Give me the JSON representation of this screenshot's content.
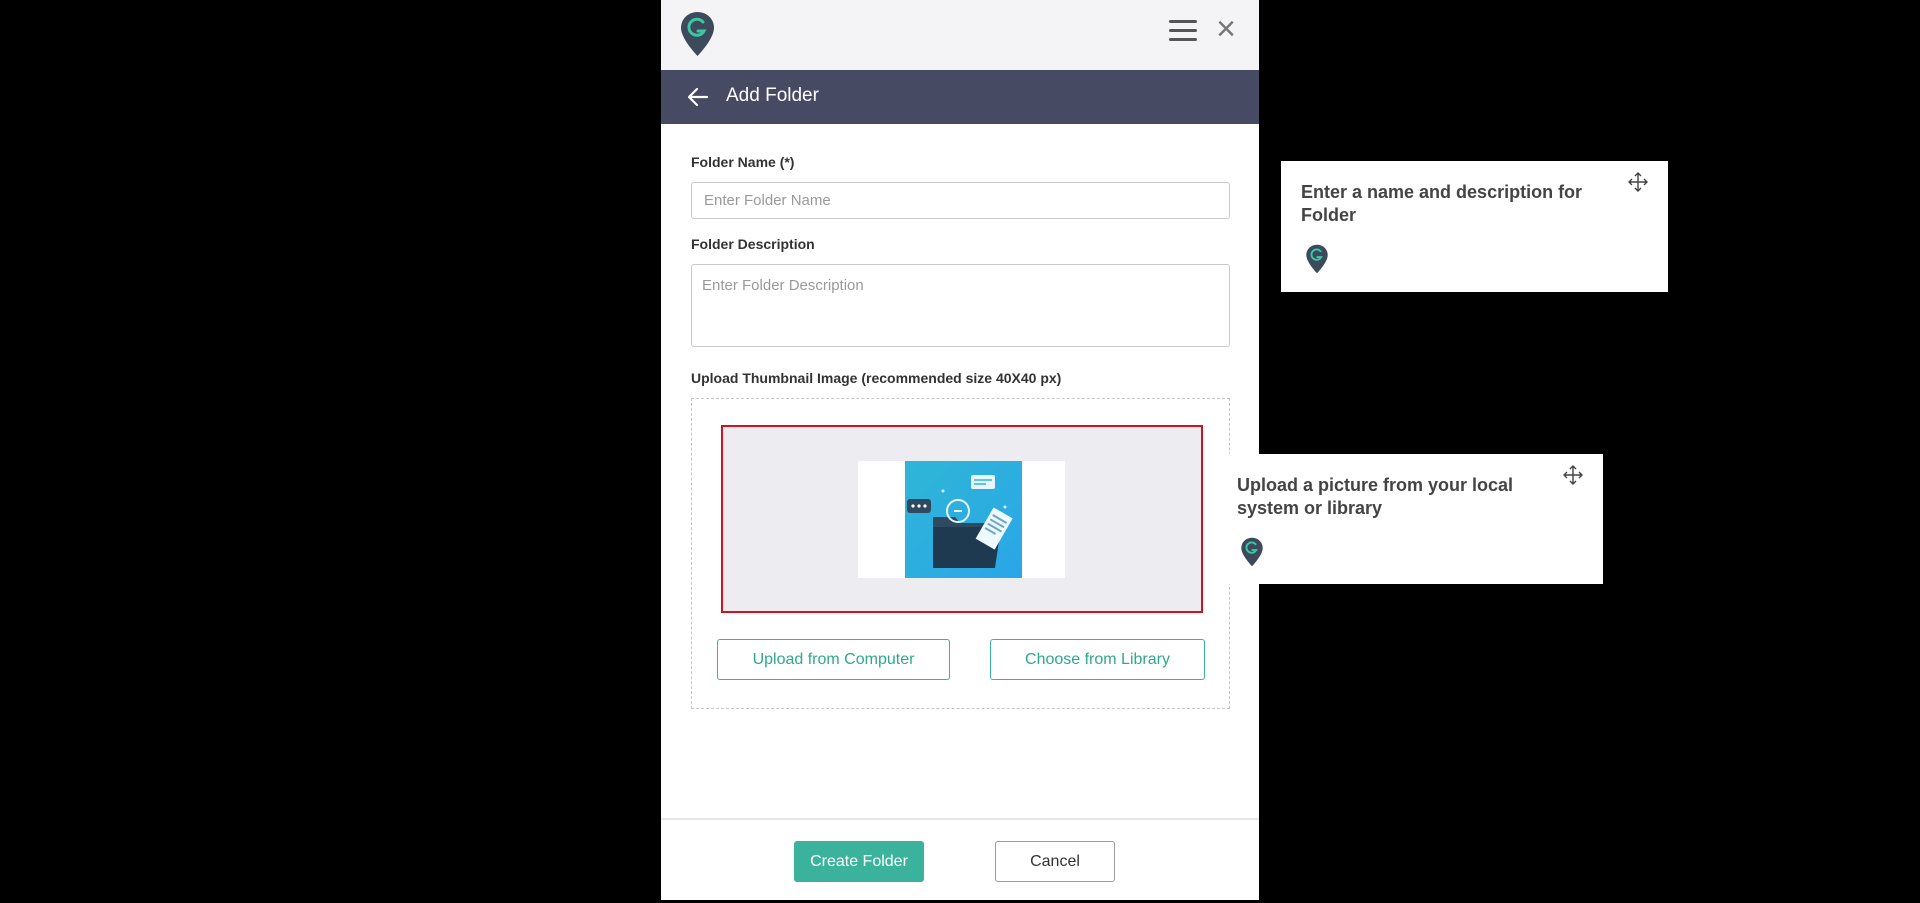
{
  "app": {
    "logo_icon": "location-pin-g-logo-icon",
    "accent_color": "#3bb39c",
    "header_color": "#474a63"
  },
  "topbar": {
    "menu_icon": "hamburger-menu-icon",
    "close_icon": "close-icon",
    "close_glyph": "×"
  },
  "header": {
    "back_icon": "arrow-left-icon",
    "title": "Add Folder"
  },
  "form": {
    "folder_name_label": "Folder Name (*)",
    "folder_name_placeholder": "Enter Folder Name",
    "folder_name_value": "",
    "folder_description_label": "Folder Description",
    "folder_description_placeholder": "Enter Folder Description",
    "folder_description_value": "",
    "thumbnail_label": "Upload Thumbnail Image (recommended size 40X40 px)",
    "thumbnail_image": "folder-illustration-image",
    "upload_computer_label": "Upload from Computer",
    "choose_library_label": "Choose from Library"
  },
  "footer": {
    "create_label": "Create Folder",
    "cancel_label": "Cancel"
  },
  "tooltips": [
    {
      "text": "Enter a name and description for Folder",
      "move_icon": "move-arrows-icon"
    },
    {
      "text": "Upload a picture from your local system or library",
      "move_icon": "move-arrows-icon"
    }
  ],
  "highlight_color": "#d0141c"
}
